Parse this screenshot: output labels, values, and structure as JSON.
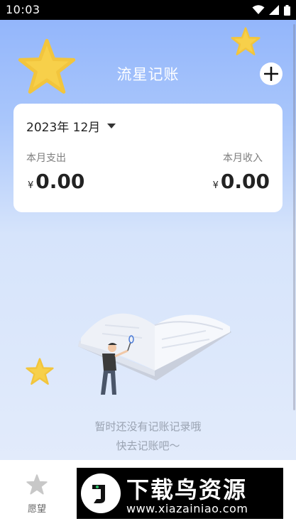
{
  "status_bar": {
    "time": "10:03"
  },
  "header": {
    "title": "流星记账"
  },
  "summary": {
    "month_label": "2023年 12月",
    "expense_label": "本月支出",
    "income_label": "本月收入",
    "currency_symbol": "¥",
    "expense_value": "0.00",
    "income_value": "0.00"
  },
  "empty_state": {
    "line1": "暂时还没有记账记录哦",
    "line2": "快去记账吧～"
  },
  "bottom_nav": {
    "items": [
      {
        "label": "愿望",
        "icon": "star-icon"
      }
    ]
  },
  "watermark": {
    "title": "下载鸟资源",
    "url": "www.xiazainiao.com"
  },
  "colors": {
    "star_yellow": "#f7d04a",
    "accent_blue": "#8fb3fb",
    "card_bg": "#ffffff"
  }
}
